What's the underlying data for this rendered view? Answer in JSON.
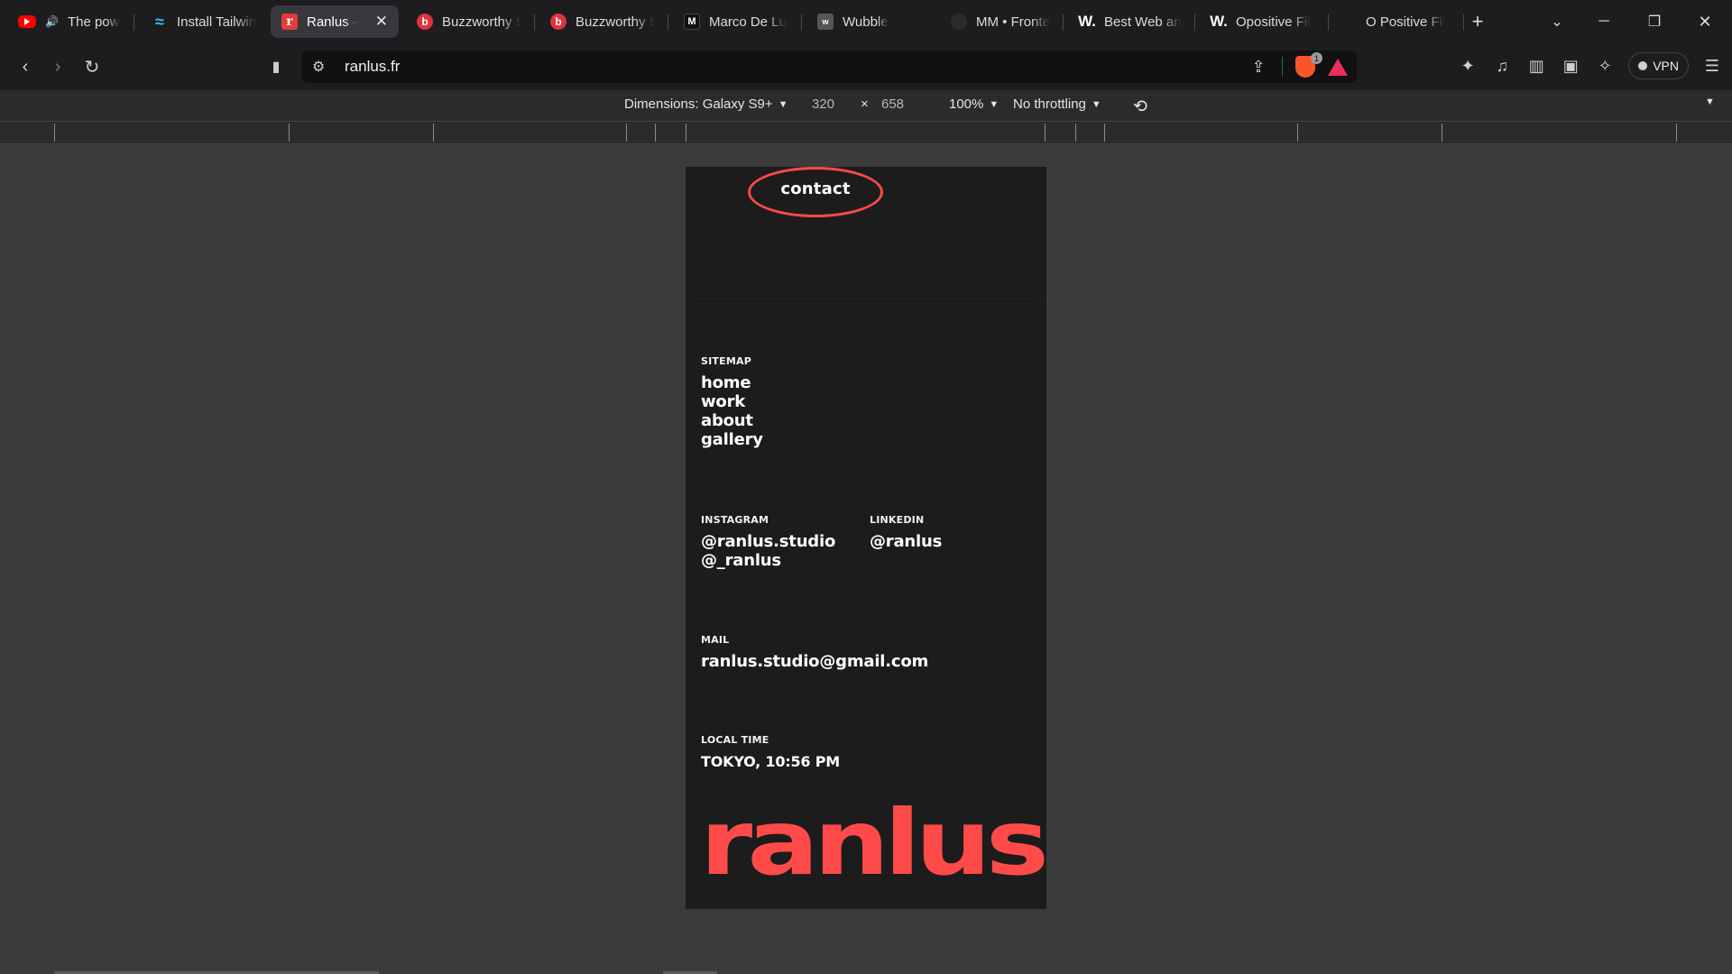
{
  "browser": {
    "tabs": [
      {
        "title": "The pow",
        "favicon": "youtube-icon"
      },
      {
        "title": "Install Tailwin",
        "favicon": "tailwind-icon"
      },
      {
        "title": "Ranlus –",
        "favicon": "ranlus-icon",
        "active": true
      },
      {
        "title": "Buzzworthy S",
        "favicon": "buzzworthy-icon"
      },
      {
        "title": "Buzzworthy S",
        "favicon": "buzzworthy-icon"
      },
      {
        "title": "Marco De Lu",
        "favicon": "marco-icon"
      },
      {
        "title": "Wubble",
        "favicon": "wubble-icon"
      },
      {
        "title": "MM • Fronte",
        "favicon": "mm-icon"
      },
      {
        "title": "Best Web an",
        "favicon": "w-icon"
      },
      {
        "title": "Opositive Fil",
        "favicon": "w-icon"
      },
      {
        "title": "O Positive Fil",
        "favicon": ""
      }
    ],
    "url": "ranlus.fr",
    "shield_badge": "1",
    "vpn_label": "VPN"
  },
  "responsive": {
    "dimensions_label": "Dimensions: Galaxy S9+",
    "width": "320",
    "times": "×",
    "height": "658",
    "zoom": "100%",
    "throttling": "No throttling"
  },
  "site": {
    "contact": "contact",
    "sitemap_label": "SITEMAP",
    "sitemap": [
      "home",
      "work",
      "about",
      "gallery"
    ],
    "instagram_label": "INSTAGRAM",
    "instagram": [
      "@ranlus.studio",
      "@_ranlus"
    ],
    "linkedin_label": "LINKEDIN",
    "linkedin": "@ranlus",
    "mail_label": "MAIL",
    "mail": "ranlus.studio@gmail.com",
    "local_time_label": "LOCAL TIME",
    "local_time": "TOKYO, 10:56 PM",
    "brand": "ranlus",
    "accent_color": "#ff4a4a"
  }
}
